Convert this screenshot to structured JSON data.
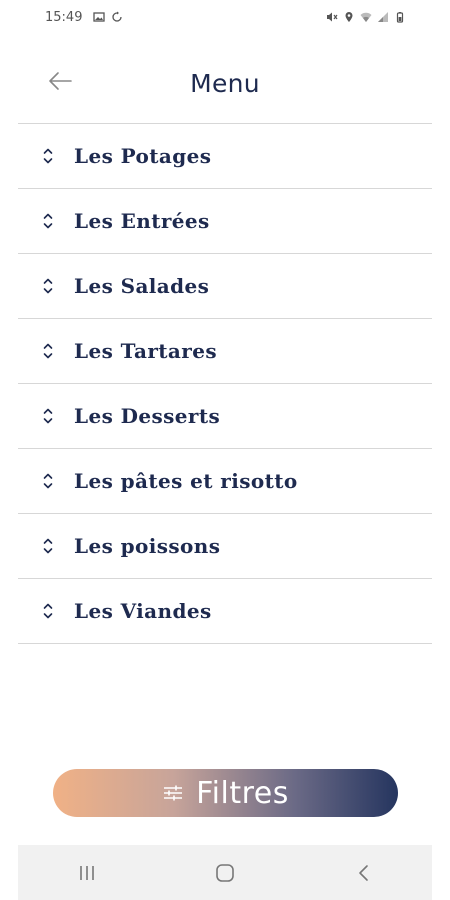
{
  "status_bar": {
    "time": "15:49",
    "left_icons": [
      "image-icon",
      "sync-icon"
    ],
    "right_icons": [
      "mute-icon",
      "location-icon",
      "wifi-icon",
      "signal-icon",
      "battery-icon"
    ]
  },
  "header": {
    "title": "Menu",
    "back_icon": "arrow-left-icon"
  },
  "menu": {
    "items": [
      {
        "label": "Les Potages"
      },
      {
        "label": "Les Entrées"
      },
      {
        "label": "Les Salades"
      },
      {
        "label": "Les Tartares"
      },
      {
        "label": "Les Desserts"
      },
      {
        "label": "Les pâtes et risotto"
      },
      {
        "label": "Les poissons"
      },
      {
        "label": "Les Viandes"
      }
    ],
    "item_icon": "expand-collapse-icon"
  },
  "filter_button": {
    "label": "Filtres",
    "icon": "sliders-icon",
    "gradient_start": "#f0b186",
    "gradient_end": "#25355f"
  },
  "nav_bar": {
    "buttons": [
      "recents-icon",
      "home-icon",
      "back-icon"
    ]
  },
  "colors": {
    "text_primary": "#1e2a4f",
    "divider": "#d7d7d7"
  }
}
